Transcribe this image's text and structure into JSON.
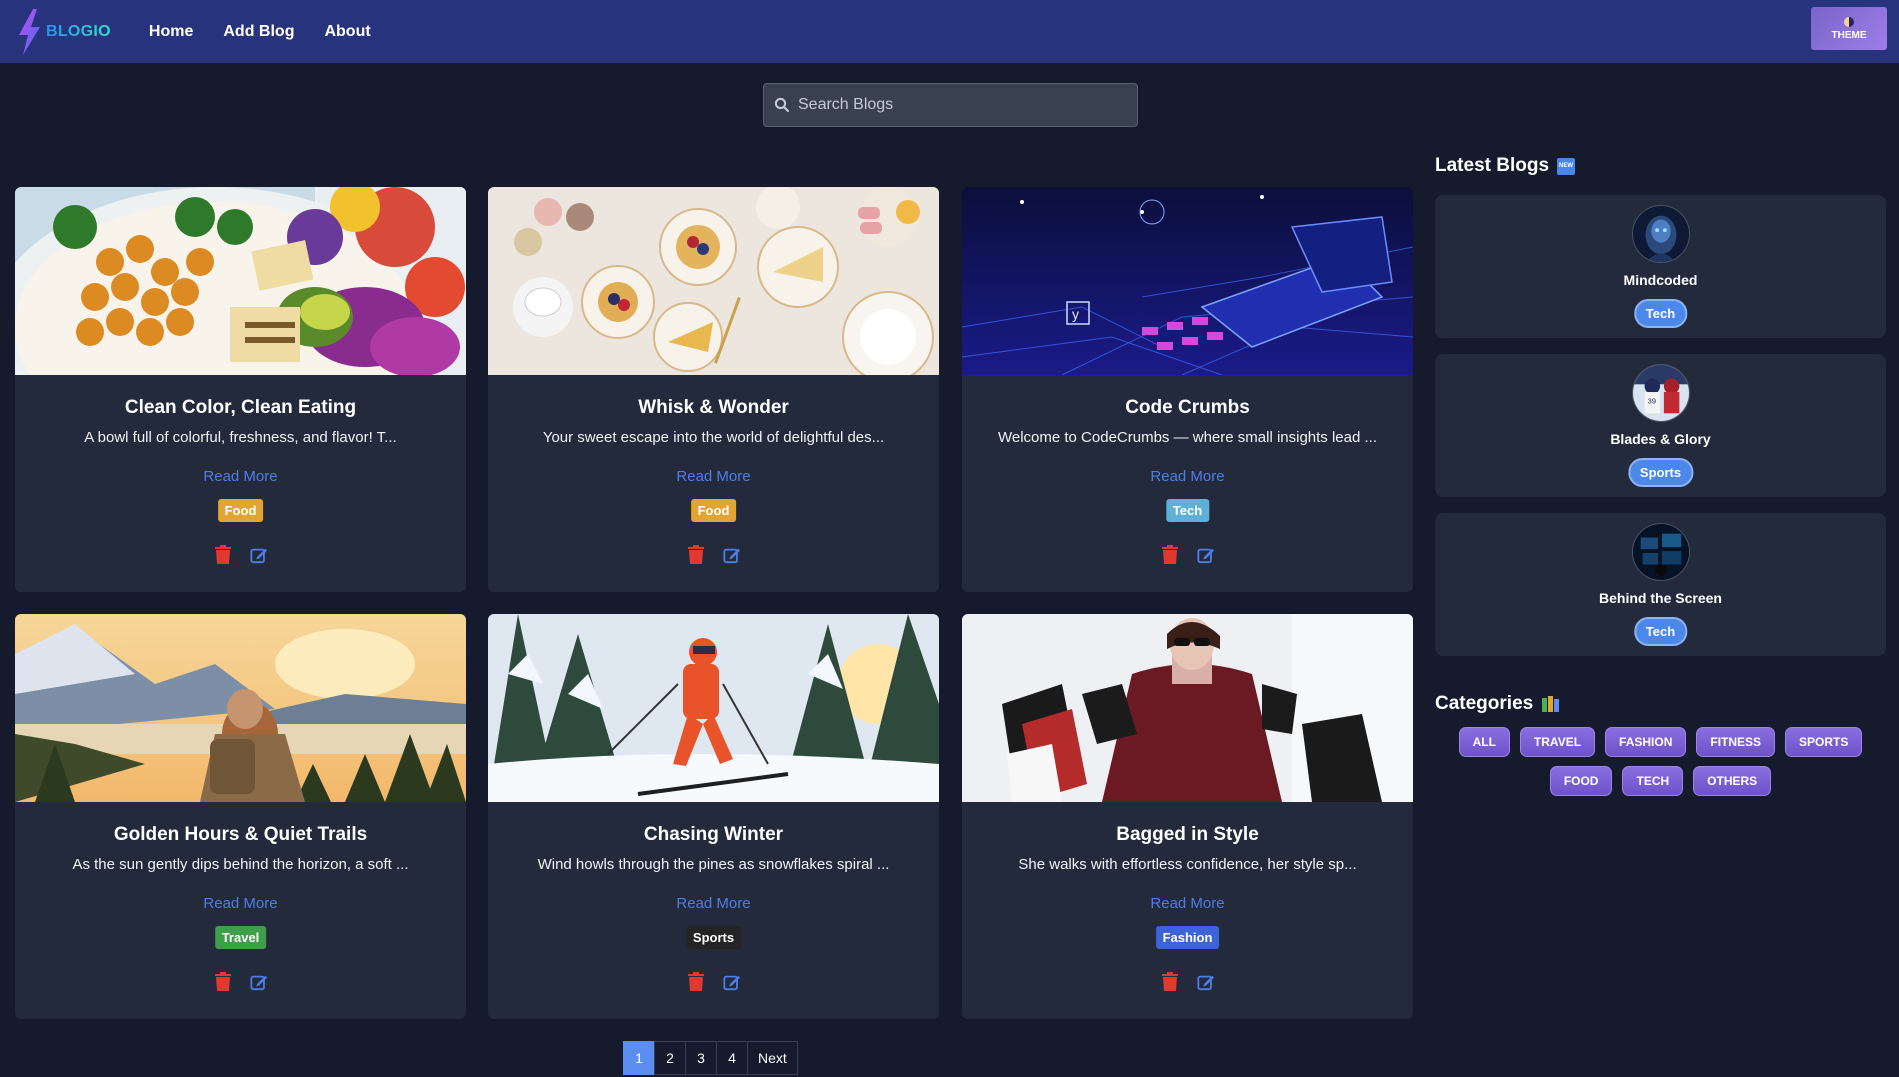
{
  "brand": {
    "name": "BLOGIO"
  },
  "nav": {
    "links": [
      "Home",
      "Add Blog",
      "About"
    ],
    "theme_label": "THEME"
  },
  "search": {
    "placeholder": "Search Blogs"
  },
  "cards": [
    {
      "title": "Clean Color, Clean Eating",
      "desc": "A bowl full of colorful, freshness, and flavor! T...",
      "read_more": "Read More",
      "tag": "Food",
      "tag_color": "#e0a532"
    },
    {
      "title": "Whisk & Wonder",
      "desc": "Your sweet escape into the world of delightful des...",
      "read_more": "Read More",
      "tag": "Food",
      "tag_color": "#e0a532"
    },
    {
      "title": "Code Crumbs",
      "desc": "Welcome to CodeCrumbs — where small insights lead ...",
      "read_more": "Read More",
      "tag": "Tech",
      "tag_color": "#5fb0d6"
    },
    {
      "title": "Golden Hours & Quiet Trails",
      "desc": "As the sun gently dips behind the horizon, a soft ...",
      "read_more": "Read More",
      "tag": "Travel",
      "tag_color": "#3f9e4a"
    },
    {
      "title": "Chasing Winter",
      "desc": "Wind howls through the pines as snowflakes spiral ...",
      "read_more": "Read More",
      "tag": "Sports",
      "tag_color": "#242424"
    },
    {
      "title": "Bagged in Style",
      "desc": "She walks with effortless confidence, her style sp...",
      "read_more": "Read More",
      "tag": "Fashion",
      "tag_color": "#3c63d8"
    }
  ],
  "pagination": {
    "pages": [
      "1",
      "2",
      "3",
      "4"
    ],
    "next": "Next",
    "active": "1"
  },
  "sidebar": {
    "latest_title": "Latest Blogs",
    "latest_badge": "NEW",
    "latest": [
      {
        "name": "Mindcoded",
        "tag": "Tech"
      },
      {
        "name": "Blades & Glory",
        "tag": "Sports"
      },
      {
        "name": "Behind the Screen",
        "tag": "Tech"
      }
    ],
    "categories_title": "Categories",
    "categories": [
      "ALL",
      "TRAVEL",
      "FASHION",
      "FITNESS",
      "SPORTS",
      "FOOD",
      "TECH",
      "OTHERS"
    ]
  },
  "colors": {
    "navbar": "#27337d",
    "background": "#151b2c",
    "card": "#222a3c",
    "link": "#4f7de8",
    "accent": "#5b8ef0",
    "delete": "#e0392f",
    "edit": "#4f7de8"
  }
}
